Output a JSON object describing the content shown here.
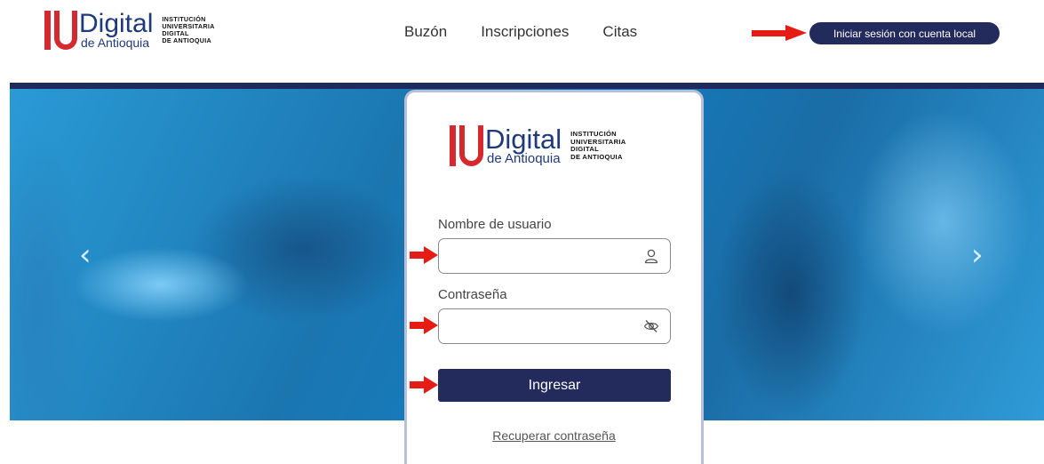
{
  "header": {
    "logo": {
      "word": "Digital",
      "sub": "de Antioquia",
      "institution_lines": [
        "INSTITUCIÓN",
        "UNIVERSITARIA",
        "DIGITAL",
        "DE ANTIOQUIA"
      ]
    },
    "nav": [
      {
        "label": "Buzón"
      },
      {
        "label": "Inscripciones"
      },
      {
        "label": "Citas"
      }
    ],
    "login_button": "Iniciar sesión con cuenta local"
  },
  "carousel": {
    "prev_icon": "chevron-left-icon",
    "next_icon": "chevron-right-icon"
  },
  "login_card": {
    "logo": {
      "word": "Digital",
      "sub": "de Antioquia",
      "institution_lines": [
        "INSTITUCIÓN",
        "UNIVERSITARIA",
        "DIGITAL",
        "DE ANTIOQUIA"
      ]
    },
    "username": {
      "label": "Nombre de usuario",
      "value": "",
      "icon": "user-icon"
    },
    "password": {
      "label": "Contraseña",
      "value": "",
      "icon": "eye-slash-icon"
    },
    "submit_label": "Ingresar",
    "recover_label": "Recuperar contraseña"
  },
  "colors": {
    "primary": "#232a5c",
    "brand_red": "#d42a2f",
    "brand_blue": "#1f3a7a",
    "annotation_arrow": "#e51b14",
    "hero_blue": "#1b76b0"
  }
}
